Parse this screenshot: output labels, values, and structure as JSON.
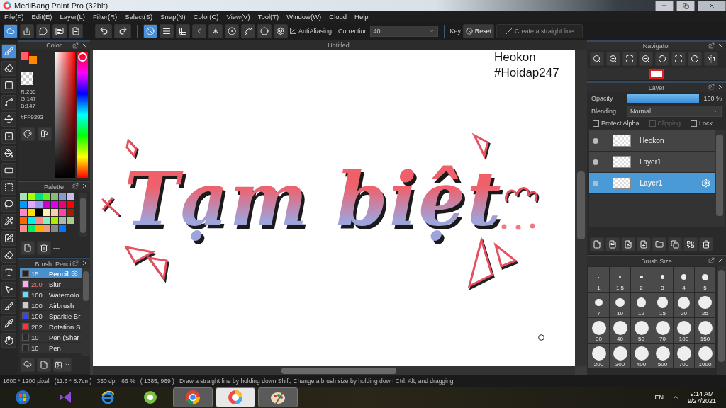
{
  "window": {
    "title": "MediBang Paint Pro (32bit)"
  },
  "menu": [
    "File(F)",
    "Edit(E)",
    "Layer(L)",
    "Filter(R)",
    "Select(S)",
    "Snap(N)",
    "Color(C)",
    "View(V)",
    "Tool(T)",
    "Window(W)",
    "Cloud",
    "Help"
  ],
  "toolbar": {
    "file_buttons": [
      {
        "kind": "cloud"
      },
      {
        "kind": "share"
      },
      {
        "kind": "bubble"
      },
      {
        "kind": "comment"
      },
      {
        "kind": "page"
      }
    ],
    "history_buttons": [
      {
        "kind": "undo"
      },
      {
        "kind": "redo"
      }
    ],
    "snaps": [
      {
        "kind": "off",
        "selected": true
      },
      {
        "kind": "parallel",
        "selected": false
      },
      {
        "kind": "grid",
        "selected": false
      },
      {
        "kind": "perspective",
        "selected": false
      },
      {
        "kind": "radial",
        "selected": false
      },
      {
        "kind": "concentric",
        "selected": false
      },
      {
        "kind": "curve",
        "selected": false
      },
      {
        "kind": "circle",
        "selected": false
      },
      {
        "kind": "settings",
        "selected": false
      }
    ],
    "antialiasing": {
      "label": "AntiAliasing",
      "checked": true
    },
    "correction": {
      "label": "Correction",
      "value": "40"
    },
    "key_label": "Key",
    "reset": "Reset",
    "straight_line": "Create a straight line"
  },
  "tools": [
    {
      "kind": "brush",
      "selected": true
    },
    {
      "kind": "eraser",
      "selected": false
    },
    {
      "kind": "rect",
      "selected": false
    },
    {
      "kind": "vector",
      "selected": false
    },
    {
      "kind": "move",
      "selected": false
    },
    {
      "kind": "fill-rect",
      "selected": false
    },
    {
      "kind": "bucket",
      "selected": false
    },
    {
      "kind": "gradient",
      "selected": false
    },
    {
      "kind": "select",
      "selected": false
    },
    {
      "kind": "lasso",
      "selected": false
    },
    {
      "kind": "wand",
      "selected": false
    },
    {
      "kind": "select-pen",
      "selected": false
    },
    {
      "kind": "select-eraser",
      "selected": false
    },
    {
      "kind": "text",
      "selected": false
    },
    {
      "kind": "operation",
      "selected": false
    },
    {
      "kind": "divide",
      "selected": false
    },
    {
      "kind": "dropper",
      "selected": false
    },
    {
      "kind": "hand",
      "selected": false
    }
  ],
  "color_panel": {
    "title": "Color",
    "swatches": [
      {
        "color": "#ff5f6a"
      },
      {
        "color": "#ff8a00"
      }
    ],
    "hue": {
      "level": 0.04
    },
    "rgb": [
      "R:255",
      "G:147",
      "B:147"
    ],
    "hex": "#FF9393"
  },
  "palette": {
    "title": "Palette",
    "colors": [
      {
        "color": "#a8e0b8"
      },
      {
        "color": "#aaff00"
      },
      {
        "color": "#00e080"
      },
      {
        "color": "#66ee22"
      },
      {
        "color": "#88bb77"
      },
      {
        "color": "#8899cc"
      },
      {
        "color": "#ccbbee"
      },
      {
        "color": "#0099ff"
      },
      {
        "color": "#ddaaff"
      },
      {
        "color": "#9999ee"
      },
      {
        "color": "#cc00cc"
      },
      {
        "color": "#dd00ee"
      },
      {
        "color": "#ee0077"
      },
      {
        "color": "#ff0000"
      },
      {
        "color": "#ff88cc"
      },
      {
        "color": "#ffdd00"
      },
      {
        "color": "#000000"
      },
      {
        "color": "#ffeebb"
      },
      {
        "color": "#ffccaa"
      },
      {
        "color": "#ff44aa"
      },
      {
        "color": "#992200"
      },
      {
        "color": "#ff6600"
      },
      {
        "color": "#00eeee"
      },
      {
        "color": "#ff8888"
      },
      {
        "color": "#88eebb"
      },
      {
        "color": "#aaee00"
      },
      {
        "color": "#aabbaa"
      },
      {
        "color": "#aacc88"
      },
      {
        "color": "#ff8a8a"
      },
      {
        "color": "#00ee66"
      },
      {
        "color": "#ffaa00"
      },
      {
        "color": "#ee9977"
      },
      {
        "color": "#888888"
      },
      {
        "color": "#0077ff"
      }
    ],
    "name": "---"
  },
  "brush_panel": {
    "title": "Brush: Pencil",
    "brushes": [
      {
        "size": "15",
        "name": "Pencil",
        "color": "#222222",
        "selected": true
      },
      {
        "size": "200",
        "name": "Blur",
        "color": "#ffaaee",
        "selected": false
      },
      {
        "size": "100",
        "name": "Watercolo",
        "color": "#66ddff",
        "selected": false
      },
      {
        "size": "100",
        "name": "Airbrush",
        "color": "#cccccc",
        "selected": false
      },
      {
        "size": "100",
        "name": "Sparkle Br",
        "color": "#3344ff",
        "selected": false
      },
      {
        "size": "282",
        "name": "Rotation S",
        "color": "#ff3333",
        "selected": false
      },
      {
        "size": "10",
        "name": "Pen (Shar",
        "color": "#2a2a2a",
        "selected": false
      },
      {
        "size": "10",
        "name": "Pen",
        "color": "#2a2a2a",
        "selected": false
      }
    ]
  },
  "canvas": {
    "tab": "Untitled",
    "notes": [
      "Heokon",
      "#Hoidap247"
    ],
    "lettering": "Tạm biệt"
  },
  "navigator": {
    "title": "Navigator",
    "buttons": [
      {
        "kind": "zoom-reset"
      },
      {
        "kind": "zoom-in"
      },
      {
        "kind": "fit"
      },
      {
        "kind": "zoom-out"
      },
      {
        "kind": "rotate-left"
      },
      {
        "kind": "fullscreen"
      },
      {
        "kind": "rotate-right"
      },
      {
        "kind": "flip"
      }
    ]
  },
  "layer_panel": {
    "title": "Layer",
    "opacity_label": "Opacity",
    "opacity": {
      "level": 1,
      "reading": "100 %"
    },
    "blending_label": "Blending",
    "blending": "Normal",
    "options": [
      {
        "label": "Protect Alpha",
        "checked": false,
        "disabled": false
      },
      {
        "label": "Clipping",
        "checked": false,
        "disabled": true
      },
      {
        "label": "Lock",
        "checked": false,
        "disabled": false
      }
    ],
    "layers": [
      {
        "name": "Heokon",
        "selected": false
      },
      {
        "name": "Layer1",
        "selected": false
      },
      {
        "name": "Layer1",
        "selected": true
      }
    ],
    "buttons": [
      {
        "kind": "new"
      },
      {
        "kind": "copy"
      },
      {
        "kind": "import"
      },
      {
        "kind": "add"
      },
      {
        "kind": "folder"
      },
      {
        "kind": "duplicate"
      },
      {
        "kind": "merge"
      },
      {
        "kind": "delete"
      }
    ]
  },
  "brush_size": {
    "title": "Brush Size",
    "sizes": [
      "1",
      "1.5",
      "2",
      "3",
      "4",
      "5",
      "7",
      "10",
      "12",
      "15",
      "20",
      "25",
      "30",
      "40",
      "50",
      "70",
      "100",
      "150",
      "200",
      "300",
      "400",
      "500",
      "700",
      "1000"
    ]
  },
  "status_bar": [
    "1600 * 1200 pixel",
    "(11.6 * 8.7cm)",
    "350 dpi",
    "66 %",
    "( 1385, 969 )",
    "Draw a straight line by holding down Shift, Change a brush size by holding down Ctrl, Alt, and dragging"
  ],
  "taskbar": {
    "apps": [
      {
        "kind": "start",
        "running": false,
        "selected": false
      },
      {
        "kind": "studio",
        "running": false,
        "selected": false
      },
      {
        "kind": "ie",
        "running": false,
        "selected": false
      },
      {
        "kind": "browser-ring",
        "running": false,
        "selected": false
      },
      {
        "kind": "chrome",
        "running": true,
        "selected": false
      },
      {
        "kind": "medibang",
        "running": true,
        "selected": true
      },
      {
        "kind": "paint",
        "running": true,
        "selected": false
      }
    ],
    "language": "EN",
    "time": "9:14 AM",
    "date": "9/27/2021"
  }
}
